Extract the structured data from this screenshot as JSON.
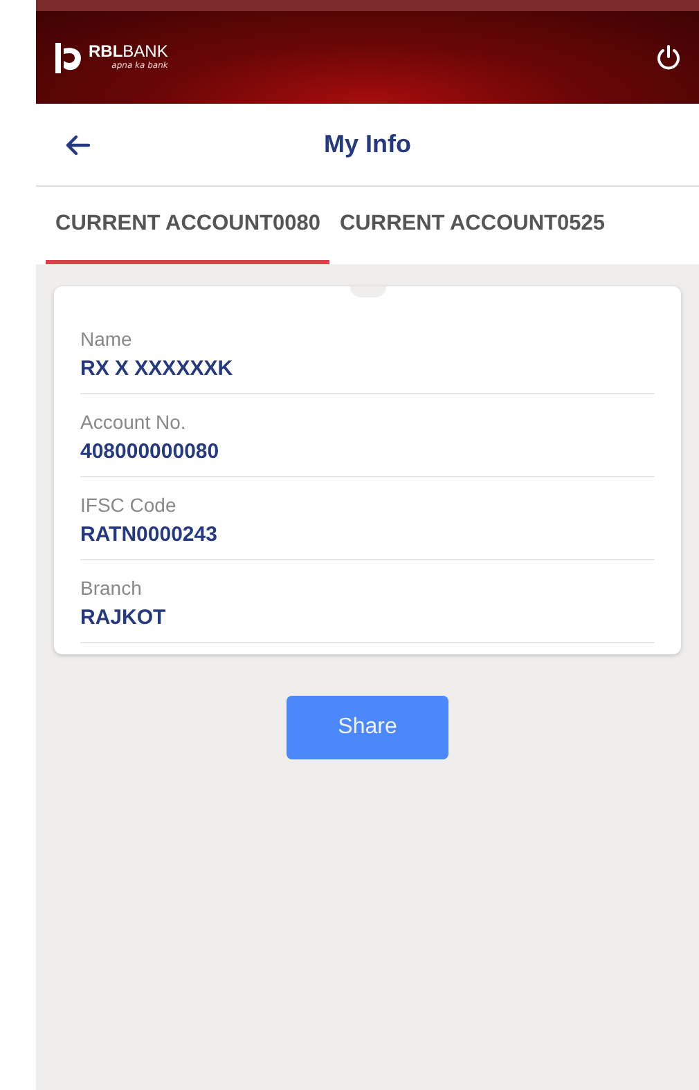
{
  "header": {
    "logo_text": "**RBL**BANK",
    "tagline": "apna ka bank"
  },
  "title_bar": {
    "title": "My Info"
  },
  "tabs": [
    {
      "label": "CURRENT ACCOUNT0080",
      "selected": true
    },
    {
      "label": "CURRENT ACCOUNT0525",
      "selected": false
    }
  ],
  "details": [
    {
      "label": "Name",
      "value": "RX X XXXXXXK"
    },
    {
      "label": "Account No.",
      "value": "408000000080"
    },
    {
      "label": "IFSC Code",
      "value": "RATN0000243"
    },
    {
      "label": "Branch",
      "value": "RAJKOT"
    }
  ],
  "share_button": "Share"
}
